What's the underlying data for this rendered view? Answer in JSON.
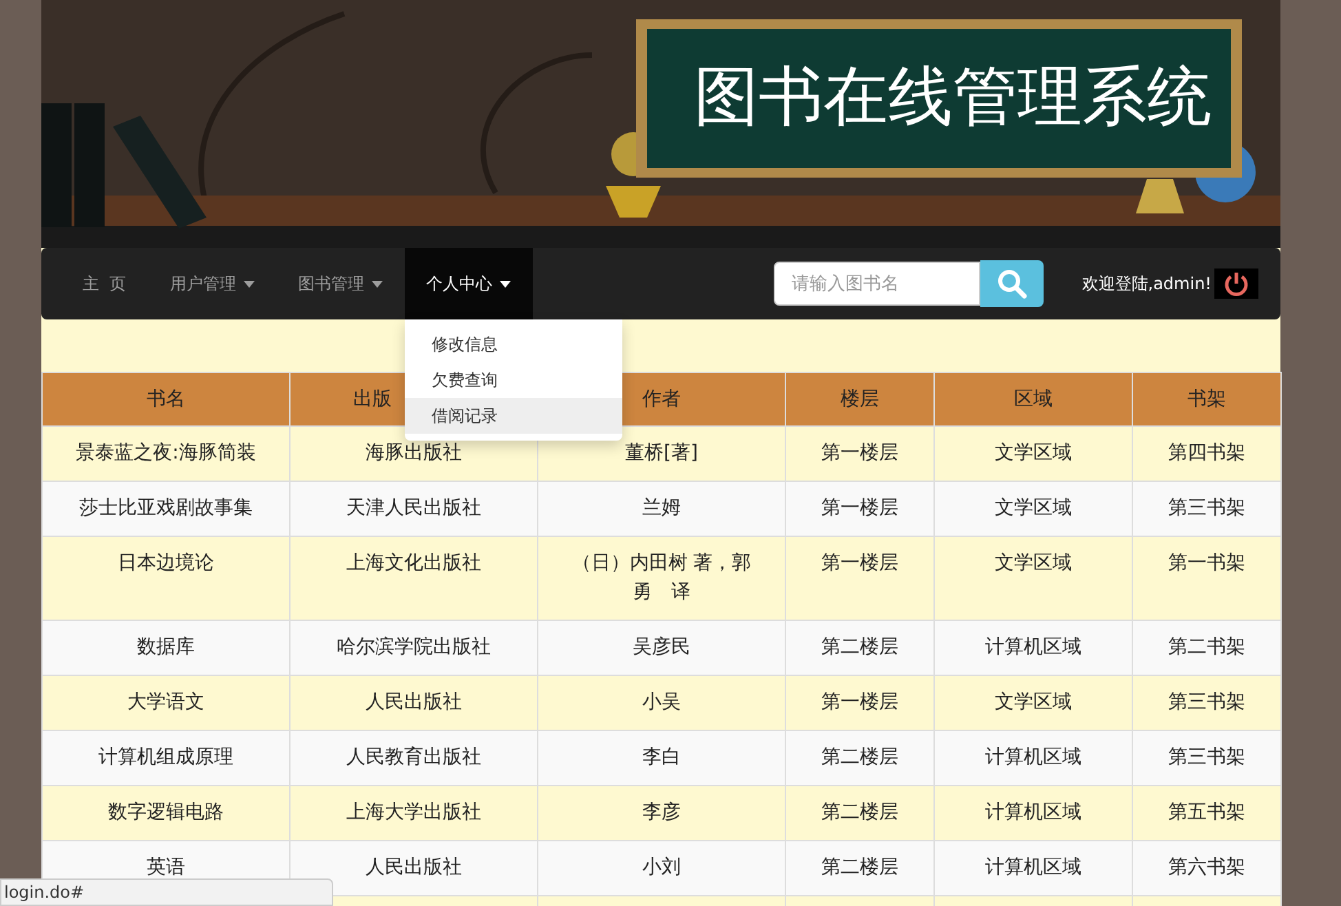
{
  "banner": {
    "title": "图书在线管理系统"
  },
  "nav": {
    "items": [
      {
        "label": "主  页",
        "caret": false,
        "selected": false
      },
      {
        "label": "用户管理",
        "caret": true,
        "selected": false
      },
      {
        "label": "图书管理",
        "caret": true,
        "selected": false
      },
      {
        "label": "个人中心",
        "caret": true,
        "selected": true
      }
    ],
    "dropdown": [
      {
        "label": "修改信息",
        "selected": false
      },
      {
        "label": "欠费查询",
        "selected": false
      },
      {
        "label": "借阅记录",
        "selected": true
      }
    ],
    "search": {
      "placeholder": "请输入图书名"
    },
    "welcome": "欢迎登陆,admin!"
  },
  "table": {
    "columns": [
      "书名",
      "出版",
      "作者",
      "楼层",
      "区域",
      "书架"
    ],
    "rows": [
      [
        "景泰蓝之夜:海豚简装",
        "海豚出版社",
        "董桥[著]",
        "第一楼层",
        "文学区域",
        "第四书架"
      ],
      [
        "莎士比亚戏剧故事集",
        "天津人民出版社",
        "兰姆",
        "第一楼层",
        "文学区域",
        "第三书架"
      ],
      [
        "日本边境论",
        "上海文化出版社",
        "（日）内田树 著，郭勇　译",
        "第一楼层",
        "文学区域",
        "第一书架"
      ],
      [
        "数据库",
        "哈尔滨学院出版社",
        "吴彦民",
        "第二楼层",
        "计算机区域",
        "第二书架"
      ],
      [
        "大学语文",
        "人民出版社",
        "小吴",
        "第一楼层",
        "文学区域",
        "第三书架"
      ],
      [
        "计算机组成原理",
        "人民教育出版社",
        "李白",
        "第二楼层",
        "计算机区域",
        "第三书架"
      ],
      [
        "数字逻辑电路",
        "上海大学出版社",
        "李彦",
        "第二楼层",
        "计算机区域",
        "第五书架"
      ],
      [
        "英语",
        "人民出版社",
        "小刘",
        "第二楼层",
        "计算机区域",
        "第六书架"
      ]
    ]
  },
  "status_bar": "login.do#"
}
